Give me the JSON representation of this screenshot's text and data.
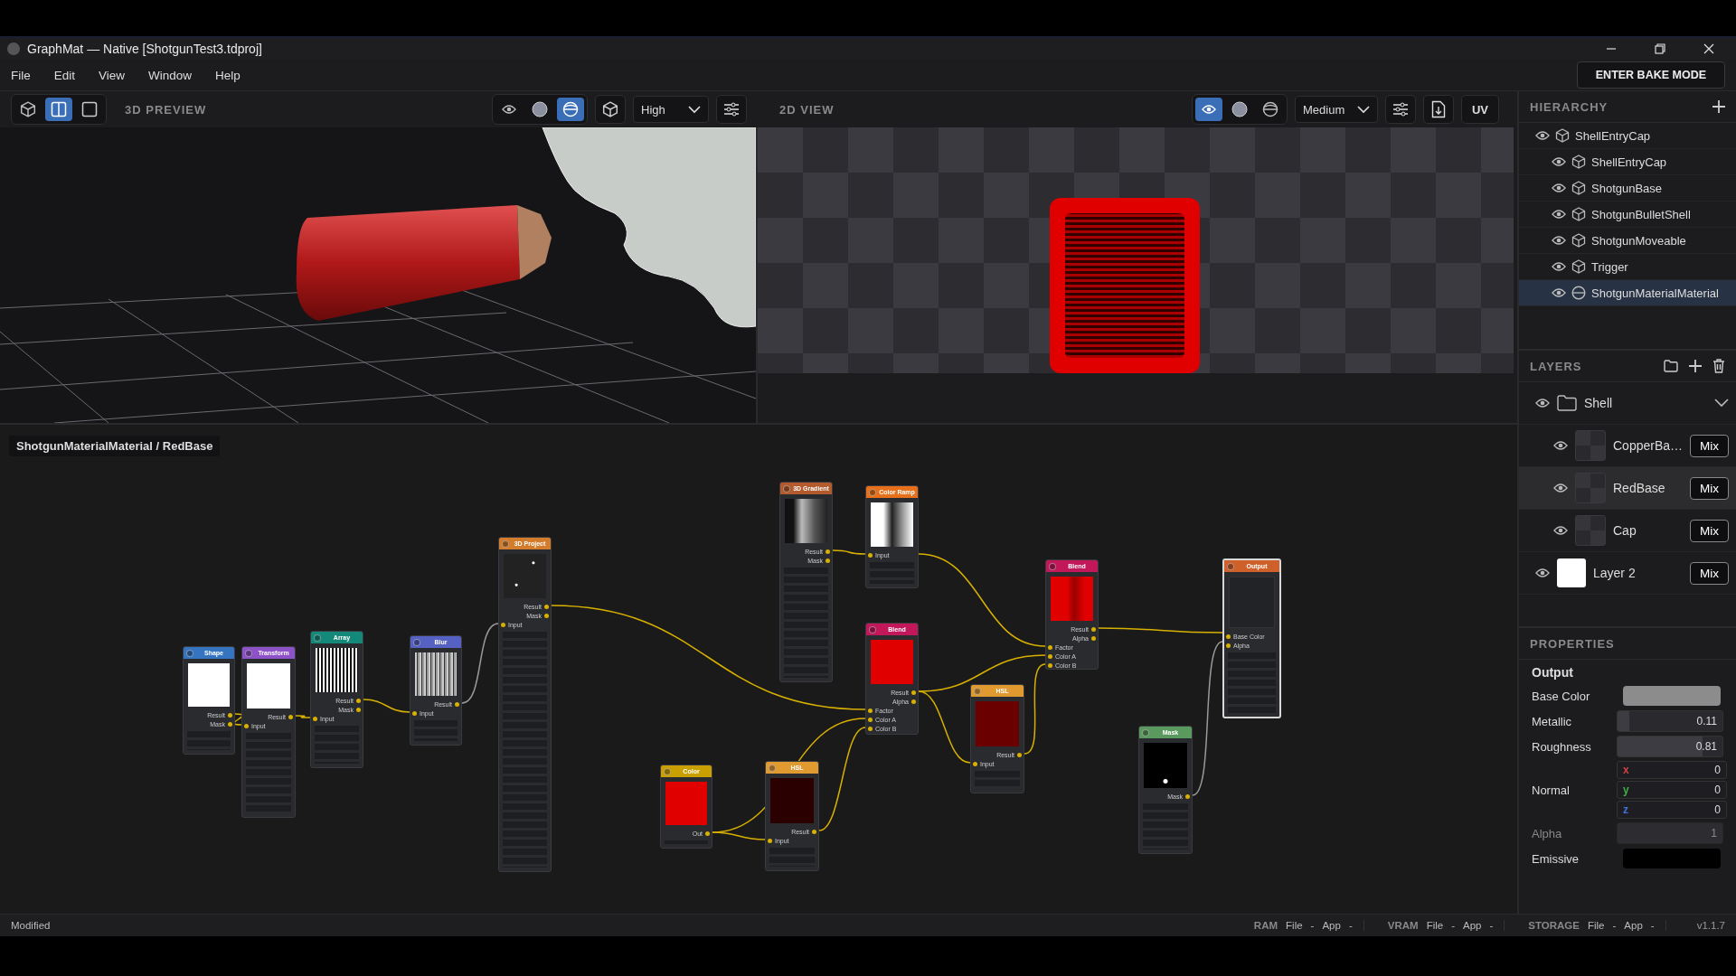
{
  "window": {
    "title": "GraphMat — Native [ShotgunTest3.tdproj]"
  },
  "menu": [
    "File",
    "Edit",
    "View",
    "Window",
    "Help"
  ],
  "bake_button": "ENTER BAKE MODE",
  "preview_toolbar": {
    "layouts": [
      {
        "kind": "cube",
        "selected": false
      },
      {
        "kind": "split",
        "selected": true
      },
      {
        "kind": "single",
        "selected": false
      }
    ],
    "label": "3D PREVIEW",
    "modes": [
      {
        "kind": "eye",
        "selected": false
      },
      {
        "kind": "solid",
        "selected": false
      },
      {
        "kind": "wire",
        "selected": true
      }
    ],
    "quality": "High"
  },
  "view_toolbar": {
    "label": "2D VIEW",
    "modes": [
      {
        "kind": "eye",
        "selected": true
      },
      {
        "kind": "solid",
        "selected": false
      },
      {
        "kind": "wire",
        "selected": false
      }
    ],
    "quality": "Medium",
    "uv_button": "UV"
  },
  "breadcrumb": "ShotgunMaterialMaterial / RedBase",
  "graph": {
    "nodes": [
      {
        "title": "Shape",
        "color": "#3474c0",
        "kind": "white",
        "outputs": [
          "Result",
          "Mask"
        ],
        "selected": false
      },
      {
        "title": "Transform",
        "color": "#8e52c8",
        "kind": "white",
        "outputs": [
          "Result"
        ],
        "inputs": [
          "Input"
        ],
        "selected": false
      },
      {
        "title": "Array",
        "color": "#14897a",
        "kind": "stripes",
        "outputs": [
          "Result",
          "Mask"
        ],
        "inputs": [
          "Input"
        ],
        "selected": false
      },
      {
        "title": "Blur",
        "color": "#5562c4",
        "kind": "soft",
        "outputs": [
          "Result"
        ],
        "inputs": [
          "Input"
        ],
        "selected": false
      },
      {
        "title": "3D Project",
        "color": "#d27c2c",
        "kind": "sparse",
        "outputs": [
          "Result",
          "Mask"
        ],
        "inputs": [
          "Input"
        ],
        "selected": false
      },
      {
        "title": "Color",
        "color": "#c9a000",
        "kind": "red",
        "outputs": [
          "Out"
        ],
        "selected": false
      },
      {
        "title": "HSL",
        "color": "#e09a30",
        "kind": "maroon",
        "outputs": [
          "Result"
        ],
        "inputs": [
          "Input"
        ],
        "selected": false
      },
      {
        "title": "3D Gradient",
        "color": "#b45a2c",
        "kind": "grayscale",
        "outputs": [
          "Result",
          "Mask"
        ],
        "selected": false
      },
      {
        "title": "Color Ramp",
        "color": "#e8701a",
        "kind": "ramp",
        "inputs": [
          "Input"
        ],
        "selected": false
      },
      {
        "title": "Blend",
        "color": "#c2185b",
        "kind": "red",
        "outputs": [
          "Result",
          "Alpha"
        ],
        "inputs": [
          "Factor",
          "Color A",
          "Color B"
        ],
        "selected": false
      },
      {
        "title": "HSL",
        "color": "#e09a30",
        "kind": "darkred",
        "outputs": [
          "Result"
        ],
        "inputs": [
          "Input"
        ],
        "selected": false
      },
      {
        "title": "Blend",
        "color": "#c2185b",
        "kind": "redmap",
        "outputs": [
          "Result",
          "Alpha"
        ],
        "inputs": [
          "Factor",
          "Color A",
          "Color B"
        ],
        "selected": false
      },
      {
        "title": "Output",
        "color": "#d0602a",
        "kind": "output",
        "inputs": [
          "Base Color",
          "Alpha"
        ],
        "selected": true
      },
      {
        "title": "Mask",
        "color": "#5a9a5e",
        "kind": "mask",
        "outputs": [
          "Mask"
        ],
        "selected": false
      }
    ]
  },
  "hierarchy": {
    "title": "HIERARCHY",
    "items": [
      {
        "label": "ShellEntryCap",
        "kind": "mesh",
        "selected": false,
        "children": [
          {
            "label": "ShellEntryCap",
            "kind": "mesh",
            "selected": false
          },
          {
            "label": "ShotgunBase",
            "kind": "mesh",
            "selected": false
          },
          {
            "label": "ShotgunBulletShell",
            "kind": "mesh",
            "selected": false
          },
          {
            "label": "ShotgunMoveable",
            "kind": "mesh",
            "selected": false
          },
          {
            "label": "Trigger",
            "kind": "mesh",
            "selected": false
          },
          {
            "label": "ShotgunMaterialMaterial",
            "kind": "material",
            "selected": true
          }
        ]
      }
    ]
  },
  "layers": {
    "title": "LAYERS",
    "items": [
      {
        "label": "Shell",
        "kind": "folder",
        "expanded": true,
        "selected": false,
        "children": [
          {
            "label": "CopperBa…",
            "kind": "layer",
            "blend": "Mix",
            "selected": false
          },
          {
            "label": "RedBase",
            "kind": "layer",
            "blend": "Mix",
            "selected": true
          },
          {
            "label": "Cap",
            "kind": "layer",
            "blend": "Mix",
            "selected": false
          }
        ]
      },
      {
        "label": "Layer 2",
        "kind": "fill",
        "blend": "Mix",
        "selected": false
      }
    ]
  },
  "properties": {
    "title": "PROPERTIES",
    "section": "Output",
    "fields": [
      {
        "label": "Base Color",
        "kind": "color",
        "color": "#8c8c8c",
        "disabled": false
      },
      {
        "label": "Metallic",
        "kind": "slider",
        "value": "0.11",
        "level": 0.11,
        "disabled": false
      },
      {
        "label": "Roughness",
        "kind": "slider",
        "value": "0.81",
        "level": 0.81,
        "disabled": false
      },
      {
        "label": "Normal",
        "kind": "vector",
        "disabled": false,
        "components": [
          {
            "axis": "x",
            "color": "#d04040",
            "value": "0"
          },
          {
            "axis": "y",
            "color": "#40b040",
            "value": "0"
          },
          {
            "axis": "z",
            "color": "#4070e0",
            "value": "0"
          }
        ]
      },
      {
        "label": "Alpha",
        "kind": "slider",
        "value": "1",
        "level": 1,
        "disabled": true
      },
      {
        "label": "Emissive",
        "kind": "color",
        "color": "#000000",
        "disabled": false
      }
    ]
  },
  "status_bar": {
    "state": "Modified",
    "meters": [
      {
        "label": "RAM",
        "file": "File",
        "file_value": "-",
        "app": "App",
        "app_value": "-"
      },
      {
        "label": "VRAM",
        "file": "File",
        "file_value": "-",
        "app": "App",
        "app_value": "-"
      },
      {
        "label": "STORAGE",
        "file": "File",
        "file_value": "-",
        "app": "App",
        "app_value": "-"
      }
    ],
    "version": "v1.1.7"
  }
}
